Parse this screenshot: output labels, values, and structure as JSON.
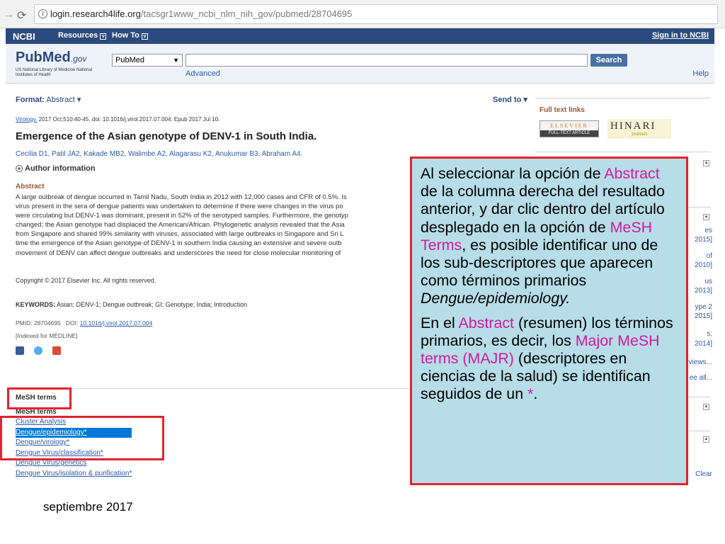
{
  "browser": {
    "back_icon": "arrow-left-icon",
    "reload_icon": "reload-icon",
    "url_host": "login.research4life.org",
    "url_path": "/tacsgr1www_ncbi_nlm_nih_gov/pubmed/28704695"
  },
  "ncbi": {
    "logo": "NCBI",
    "resources": "Resources",
    "how_to": "How To",
    "sign_in": "Sign in to NCBI"
  },
  "search": {
    "logo_main": "PubMed",
    "logo_gov": ".gov",
    "logo_sub": "US National Library of Medicine National Institutes of Health",
    "db_value": "PubMed",
    "query": "",
    "button": "Search",
    "advanced": "Advanced",
    "help": "Help"
  },
  "article": {
    "format_label": "Format:",
    "format_value": "Abstract",
    "send_to": "Send to",
    "journal": "Virology.",
    "citation_rest": " 2017 Oct;510:40-45. doi: 10.1016/j.virol.2017.07.004. Epub 2017 Jul 10.",
    "title": "Emergence of the Asian genotype of DENV-1 in South India.",
    "authors": "Cecilia D1, Patil JA2, Kakade MB2, Walimbe A2, Alagarasu K2, Anukumar B3, Abraham A4.",
    "author_info": "Author information",
    "abstract_heading": "Abstract",
    "abstract_lines": [
      "A large outbreak of dengue occurred in Tamil Nadu, South India in 2012 with 12,000 cases and CFR of 0.5%. Is",
      "virus present in the sera of dengue patients was undertaken to determine if there were changes in the virus po",
      "were circulating but DENV-1 was dominant, present in 52% of the serotyped samples. Furthermore, the genotyp",
      "changed; the Asian genotype had displaced the American/African. Phylogenetic analysis revealed that the Asia",
      "from Singapore and shared 99% similarity with viruses, associated with large outbreaks in Singapore and Sri L",
      "time the emergence of the Asian genotype of DENV-1 in southern India causing an extensive and severe outb",
      "movement of DENV can affect dengue outbreaks and underscores the need for close molecular monitoring of"
    ],
    "copyright": "Copyright © 2017 Elsevier Inc. All rights reserved.",
    "keywords_label": "KEYWORDS:",
    "keywords": " Asian; DENV-1; Dengue outbreak; GI; Genotype; India; Introduction",
    "pmid": "PMID: 28704695",
    "doi_label": "DOI:",
    "doi": "10.1016/j.virol.2017.07.004",
    "indexed": "[Indexed for MEDLINE]"
  },
  "mesh": {
    "heading": "MeSH terms",
    "subheading": "MeSH terms",
    "terms": [
      "Cluster Analysis",
      "Dengue/epidemiology*",
      "Dengue/virology*",
      "Dengue Virus/classification*",
      "Dengue Virus/genetics",
      "Dengue Virus/isolation & purification*"
    ]
  },
  "right_col": {
    "full_text": "Full text links",
    "elsevier_top": "ELSEVIER",
    "elsevier_bottom": "FULL-TEXT ARTICLE",
    "hinari_top": "HINARI",
    "hinari_bottom": "journals",
    "snippets": [
      "es",
      "2015]",
      "of",
      "2010]",
      "us",
      "2013]",
      "ype 2",
      "2015]",
      "s:",
      "2014]",
      "views...",
      "ee all...",
      "Clear"
    ]
  },
  "callout": {
    "p1_a": "Al seleccionar la opción de ",
    "p1_b": "Abstract",
    "p1_c": " de la columna derecha del resultado anterior, y dar clic dentro del artículo desplegado en la opción de ",
    "p1_d": "MeSH Terms",
    "p1_e": ", es posible identificar uno de los sub-descriptores que aparecen como términos primarios ",
    "p1_f": "Dengue/epidemiology.",
    "p2_a": "En el ",
    "p2_b": "Abstract",
    "p2_c": " (resumen) los términos primarios, es decir, los ",
    "p2_d": "Major MeSH terms (MAJR)",
    "p2_e": " (descriptores en ciencias de la salud) se identifican seguidos de un ",
    "p2_f": "*",
    "p2_g": "."
  },
  "footer": "septiembre 2017",
  "colors": {
    "callout_bg": "#b7dde8",
    "highlight": "#d0199c",
    "red_frame": "#e3232f",
    "ncbi_blue": "#2b4a7e"
  }
}
